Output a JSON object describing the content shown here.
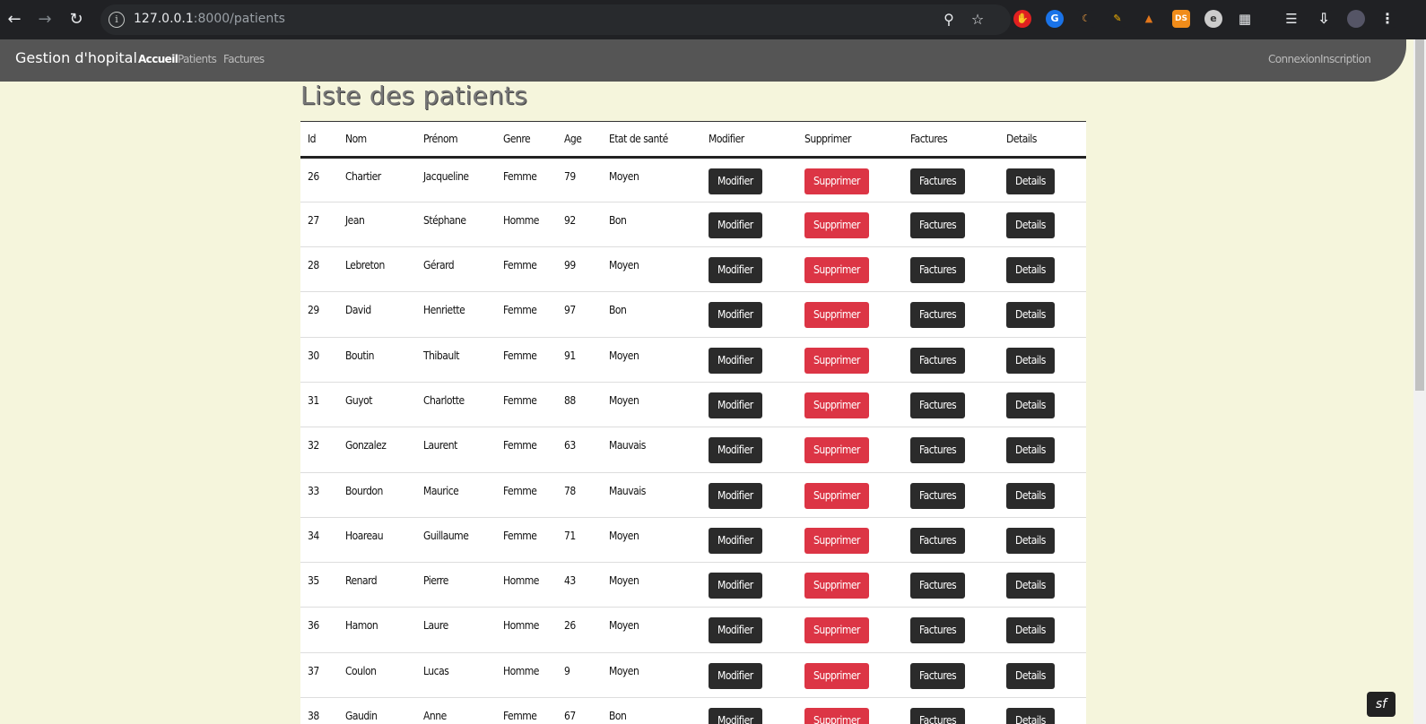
{
  "browser": {
    "url_host": "127.0.0.1",
    "url_path": ":8000/patients"
  },
  "navbar": {
    "brand": "Gestion d'hopital",
    "links": [
      "Accueil",
      "Patients",
      "Factures"
    ],
    "right_links": [
      "Connexion",
      "Inscription"
    ]
  },
  "page_title": "Liste des patients",
  "table": {
    "headers": [
      "Id",
      "Nom",
      "Prénom",
      "Genre",
      "Age",
      "Etat de santé",
      "Modifier",
      "Supprimer",
      "Factures",
      "Details"
    ],
    "action_labels": {
      "modifier": "Modifier",
      "supprimer": "Supprimer",
      "factures": "Factures",
      "details": "Details"
    },
    "rows": [
      [
        "26",
        "Chartier",
        "Jacqueline",
        "Femme",
        "79",
        "Moyen"
      ],
      [
        "27",
        "Jean",
        "Stéphane",
        "Homme",
        "92",
        "Bon"
      ],
      [
        "28",
        "Lebreton",
        "Gérard",
        "Femme",
        "99",
        "Moyen"
      ],
      [
        "29",
        "David",
        "Henriette",
        "Femme",
        "97",
        "Bon"
      ],
      [
        "30",
        "Boutin",
        "Thibault",
        "Femme",
        "91",
        "Moyen"
      ],
      [
        "31",
        "Guyot",
        "Charlotte",
        "Femme",
        "88",
        "Moyen"
      ],
      [
        "32",
        "Gonzalez",
        "Laurent",
        "Femme",
        "63",
        "Mauvais"
      ],
      [
        "33",
        "Bourdon",
        "Maurice",
        "Femme",
        "78",
        "Mauvais"
      ],
      [
        "34",
        "Hoareau",
        "Guillaume",
        "Femme",
        "71",
        "Moyen"
      ],
      [
        "35",
        "Renard",
        "Pierre",
        "Homme",
        "43",
        "Moyen"
      ],
      [
        "36",
        "Hamon",
        "Laure",
        "Homme",
        "26",
        "Moyen"
      ],
      [
        "37",
        "Coulon",
        "Lucas",
        "Homme",
        "9",
        "Moyen"
      ],
      [
        "38",
        "Gaudin",
        "Anne",
        "Femme",
        "67",
        "Bon"
      ]
    ]
  },
  "colors": {
    "navbar": "#555555",
    "page_bg": "#f5f5dc",
    "danger": "#dc3545",
    "dark_button": "#2b2b2b"
  }
}
